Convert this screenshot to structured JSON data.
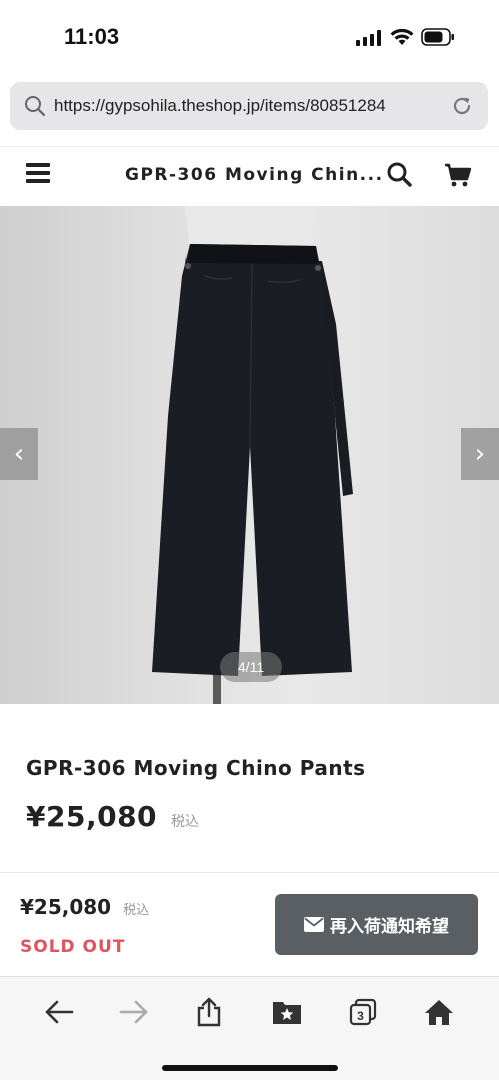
{
  "status_bar": {
    "time": "11:03"
  },
  "browser": {
    "url": "https://gypsohila.theshop.jp/items/80851284"
  },
  "site_header": {
    "title": "GPR-306 Moving Chin..."
  },
  "gallery": {
    "counter": "4/11",
    "prev_glyph": "‹",
    "next_glyph": "›"
  },
  "product": {
    "name": "GPR-306 Moving Chino Pants",
    "price": "¥25,080",
    "tax_label": "税込"
  },
  "buy_bar": {
    "price": "¥25,080",
    "tax_label": "税込",
    "status": "SOLD OUT",
    "notify_label": "再入荷通知希望"
  },
  "toolbar": {
    "tabs_count": "3"
  },
  "colors": {
    "sold_out": "#e0545f",
    "notify_button": "#5a5f63"
  },
  "icons": [
    "search-icon",
    "reload-icon",
    "menu-icon",
    "cart-icon",
    "mail-icon",
    "back-arrow-icon",
    "forward-arrow-icon",
    "share-icon",
    "bookmarks-icon",
    "tabs-icon",
    "home-icon"
  ]
}
